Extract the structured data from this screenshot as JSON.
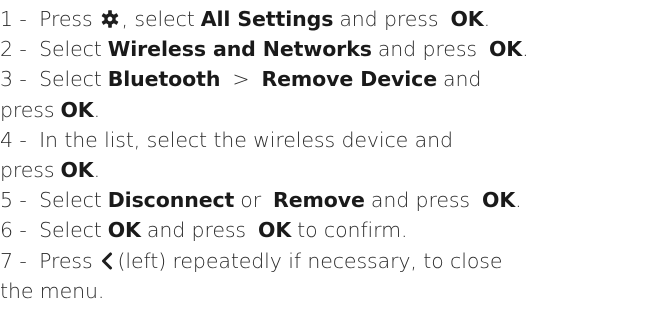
{
  "steps": [
    {
      "prefix": "1 - ",
      "t1": "Press",
      "icon": "gear-icon",
      "t2": ", select",
      "k1": "All Settings",
      "t3": "and press",
      "k2": "OK",
      "t4": "."
    },
    {
      "prefix": "2 - ",
      "t1": "Select",
      "k1": "Wireless and Networks",
      "t2": "and press",
      "k2": "OK",
      "t3": "."
    },
    {
      "prefix": "3 - ",
      "t1": "Select",
      "k1": "Bluetooth",
      "sep": ">",
      "k2": "Remove Device",
      "t2": "and",
      "cont_t1": "press",
      "cont_k1": "OK",
      "cont_t2": "."
    },
    {
      "prefix": "4 - ",
      "t1": "In the list, select the wireless device and",
      "cont_t1": "press",
      "cont_k1": "OK",
      "cont_t2": "."
    },
    {
      "prefix": "5 - ",
      "t1": "Select",
      "k1": "Disconnect",
      "t2": "or",
      "k2": "Remove",
      "t3": "and press",
      "k3": "OK",
      "t4": "."
    },
    {
      "prefix": "6 - ",
      "t1": "Select",
      "k1": "OK",
      "t2": "and press",
      "k2": "OK",
      "t3": "to confirm."
    },
    {
      "prefix": "7 - ",
      "t1": "Press",
      "icon": "chevron-left-icon",
      "t2": "(left) repeatedly if necessary, to close",
      "cont_t1": "the menu."
    }
  ]
}
